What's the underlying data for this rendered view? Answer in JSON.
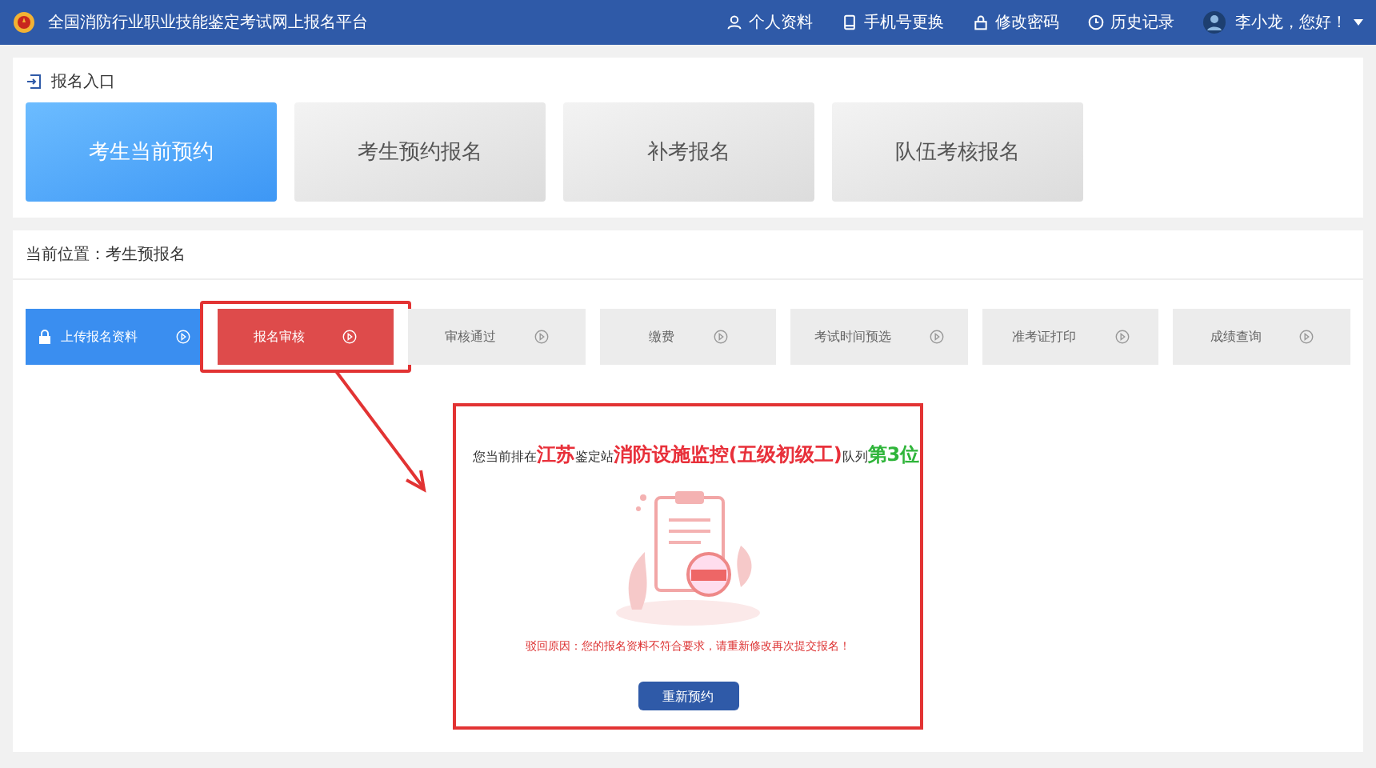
{
  "header": {
    "title": "全国消防行业职业技能鉴定考试网上报名平台",
    "links": [
      {
        "label": "个人资料",
        "kind": "user"
      },
      {
        "label": "手机号更换",
        "kind": "phone"
      },
      {
        "label": "修改密码",
        "kind": "lock"
      },
      {
        "label": "历史记录",
        "kind": "clock"
      }
    ],
    "greeting": "李小龙，您好！"
  },
  "entry": {
    "title": "报名入口",
    "cards": [
      {
        "label": "考生当前预约",
        "selected": true
      },
      {
        "label": "考生预约报名",
        "selected": false
      },
      {
        "label": "补考报名",
        "selected": false
      },
      {
        "label": "队伍考核报名",
        "selected": false
      }
    ]
  },
  "breadcrumb": "当前位置：考生预报名",
  "steps": [
    {
      "label": "上传报名资料",
      "completed": true,
      "selected": false,
      "locked": true,
      "highlighted": false
    },
    {
      "label": "报名审核",
      "completed": false,
      "selected": true,
      "locked": false,
      "highlighted": true
    },
    {
      "label": "审核通过",
      "completed": false,
      "selected": false,
      "locked": false,
      "highlighted": false
    },
    {
      "label": "缴费",
      "completed": false,
      "selected": false,
      "locked": false,
      "highlighted": false
    },
    {
      "label": "考试时间预选",
      "completed": false,
      "selected": false,
      "locked": false,
      "highlighted": false
    },
    {
      "label": "准考证打印",
      "completed": false,
      "selected": false,
      "locked": false,
      "highlighted": false
    },
    {
      "label": "成绩查询",
      "completed": false,
      "selected": false,
      "locked": false,
      "highlighted": false
    }
  ],
  "result": {
    "highlighted": true,
    "queue": [
      {
        "text": "您当前排在",
        "kind": "plain"
      },
      {
        "text": "江苏",
        "kind": "place"
      },
      {
        "text": "鉴定站",
        "kind": "plain"
      },
      {
        "text": "消防设施监控(五级初级工)",
        "kind": "place"
      },
      {
        "text": "队列",
        "kind": "plain"
      },
      {
        "text": "第3位",
        "kind": "rank"
      }
    ],
    "reason": "驳回原因：您的报名资料不符合要求，请重新修改再次提交报名！",
    "button": "重新预约"
  }
}
